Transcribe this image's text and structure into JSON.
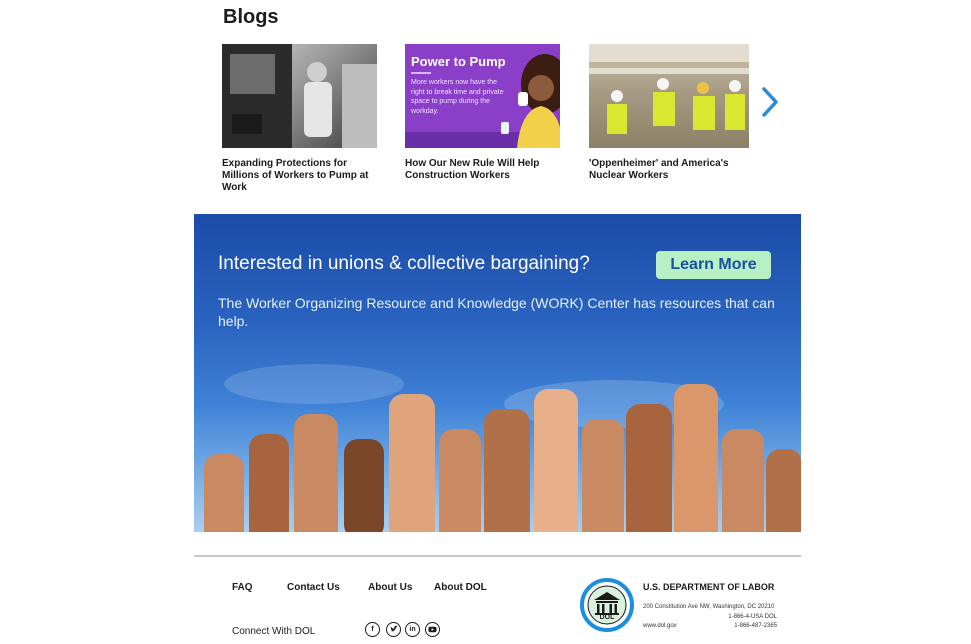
{
  "blogs": {
    "title": "Blogs",
    "items": [
      {
        "caption": "Expanding Protections for Millions of Workers to Pump at Work"
      },
      {
        "caption": "How Our New Rule Will Help Construction Workers",
        "image_title": "Power to Pump",
        "image_text": "More workers now have the right to break time and private space to pump during the workday."
      },
      {
        "caption": "'Oppenheimer' and America's Nuclear Workers"
      }
    ]
  },
  "banner": {
    "heading": "Interested in unions & collective bargaining?",
    "body": "The Worker Organizing Resource and Knowledge (WORK) Center has resources that can help.",
    "button_label": "Learn More"
  },
  "footer": {
    "links": {
      "faq": "FAQ",
      "contact": "Contact Us",
      "about_us": "About Us",
      "about_dol": "About DOL"
    },
    "connect_label": "Connect With DOL",
    "social": [
      "facebook-icon",
      "twitter-icon",
      "linkedin-icon",
      "youtube-icon"
    ],
    "org": {
      "seal_text": "DOL",
      "name": "U.S. DEPARTMENT OF LABOR",
      "address": "200 Constitution Ave NW, Washington, DC 20210",
      "phone1": "1-866-4-USA DOL",
      "web": "www.dol.gov",
      "phone2": "1-866-487-2365"
    }
  },
  "colors": {
    "banner_blue": "#1c4ba8",
    "button_green": "#b8f0c5",
    "accent_purple": "#8b3fc9",
    "chevron_blue": "#2a8bd8"
  }
}
